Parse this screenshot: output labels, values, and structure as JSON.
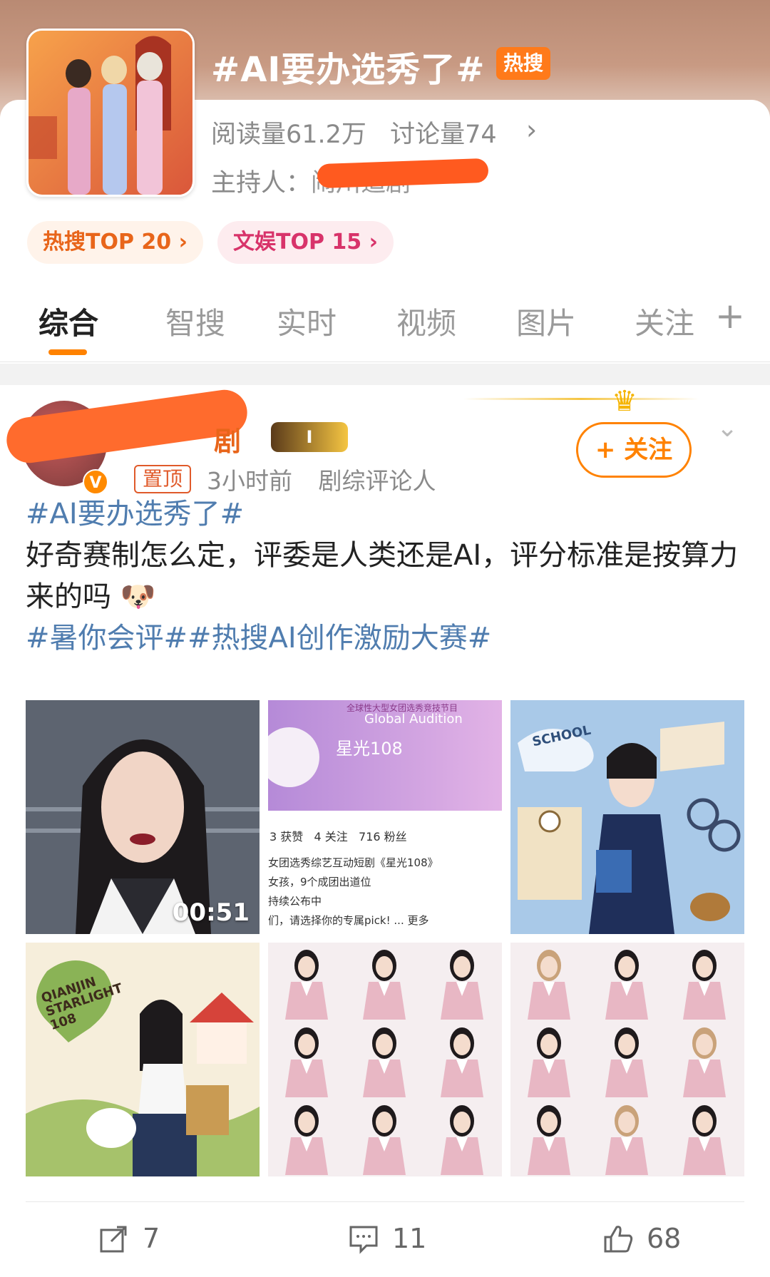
{
  "topic": {
    "title": "#AI要办选秀了#",
    "badge": "热搜",
    "reads": "阅读量61.2万",
    "discussions": "讨论量74",
    "host_label": "主持人：",
    "host_name": "闹川追剧",
    "rank_hot": "热搜TOP 20 ›",
    "rank_ent": "文娱TOP 15 ›"
  },
  "tabs": [
    "综合",
    "智搜",
    "实时",
    "视频",
    "图片",
    "关注"
  ],
  "post": {
    "author": "剧",
    "vip_label": "I",
    "pin_label": "置顶",
    "time": "3小时前",
    "role": "剧综评论人",
    "follow_label": "+ 关注",
    "line1_tag": "#AI要办选秀了#",
    "line2": "好奇赛制怎么定，评委是人类还是AI，评分标准是按算力来的吗",
    "line3_tags": "#暑你会评##热搜AI创作激励大赛#",
    "video_duration": "00:51",
    "profile_card": {
      "banner_top": "全球性大型女团选秀竞技节目",
      "banner_title": "Global Audition",
      "name": "星光108",
      "stats": "3 获赞   4 关注   716 粉丝",
      "desc1": "女团选秀综艺互动短剧《星光108》",
      "desc2": "女孩，9个成团出道位",
      "desc3": "持续公布中",
      "desc4": "们，请选择你的专属pick!  ...  更多"
    },
    "poster_text": "QIANJIN STARLIGHT 108",
    "school_text": "SCHOOL",
    "reposts": "7",
    "comments": "11",
    "likes": "68"
  }
}
